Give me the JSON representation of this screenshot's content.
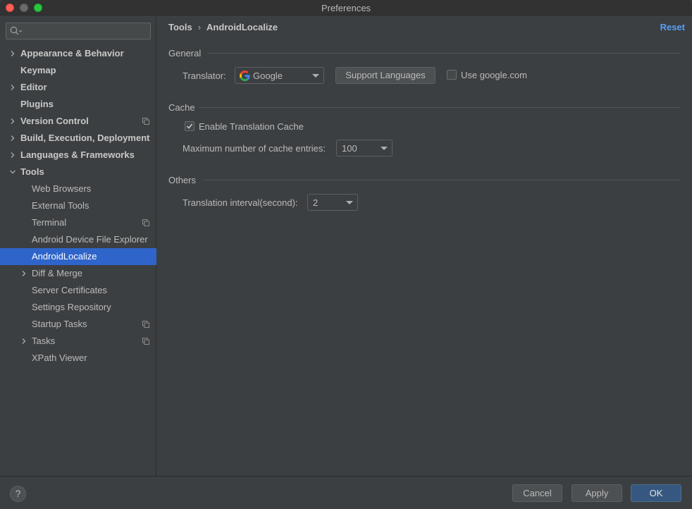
{
  "window": {
    "title": "Preferences"
  },
  "search": {
    "placeholder": ""
  },
  "sidebar": {
    "items": [
      {
        "label": "Appearance & Behavior",
        "level": 0,
        "expandable": true,
        "expanded": false,
        "badge": false,
        "selected": false
      },
      {
        "label": "Keymap",
        "level": 0,
        "expandable": false,
        "badge": false,
        "selected": false
      },
      {
        "label": "Editor",
        "level": 0,
        "expandable": true,
        "expanded": false,
        "badge": false,
        "selected": false
      },
      {
        "label": "Plugins",
        "level": 0,
        "expandable": false,
        "badge": false,
        "selected": false
      },
      {
        "label": "Version Control",
        "level": 0,
        "expandable": true,
        "expanded": false,
        "badge": true,
        "selected": false
      },
      {
        "label": "Build, Execution, Deployment",
        "level": 0,
        "expandable": true,
        "expanded": false,
        "badge": false,
        "selected": false
      },
      {
        "label": "Languages & Frameworks",
        "level": 0,
        "expandable": true,
        "expanded": false,
        "badge": false,
        "selected": false
      },
      {
        "label": "Tools",
        "level": 0,
        "expandable": true,
        "expanded": true,
        "badge": false,
        "selected": false
      },
      {
        "label": "Web Browsers",
        "level": 1,
        "expandable": false,
        "badge": false,
        "selected": false
      },
      {
        "label": "External Tools",
        "level": 1,
        "expandable": false,
        "badge": false,
        "selected": false
      },
      {
        "label": "Terminal",
        "level": 1,
        "expandable": false,
        "badge": true,
        "selected": false
      },
      {
        "label": "Android Device File Explorer",
        "level": 1,
        "expandable": false,
        "badge": false,
        "selected": false
      },
      {
        "label": "AndroidLocalize",
        "level": 1,
        "expandable": false,
        "badge": false,
        "selected": true
      },
      {
        "label": "Diff & Merge",
        "level": 1,
        "expandable": true,
        "expanded": false,
        "badge": false,
        "selected": false
      },
      {
        "label": "Server Certificates",
        "level": 1,
        "expandable": false,
        "badge": false,
        "selected": false
      },
      {
        "label": "Settings Repository",
        "level": 1,
        "expandable": false,
        "badge": false,
        "selected": false
      },
      {
        "label": "Startup Tasks",
        "level": 1,
        "expandable": false,
        "badge": true,
        "selected": false
      },
      {
        "label": "Tasks",
        "level": 1,
        "expandable": true,
        "expanded": false,
        "badge": true,
        "selected": false
      },
      {
        "label": "XPath Viewer",
        "level": 1,
        "expandable": false,
        "badge": false,
        "selected": false
      }
    ]
  },
  "breadcrumb": {
    "parent": "Tools",
    "separator": "›",
    "current": "AndroidLocalize"
  },
  "reset_label": "Reset",
  "general": {
    "title": "General",
    "translator_label": "Translator:",
    "translator_value": "Google",
    "support_languages_label": "Support Languages",
    "use_google_label": "Use google.com",
    "use_google_checked": false
  },
  "cache": {
    "title": "Cache",
    "enable_label": "Enable Translation Cache",
    "enable_checked": true,
    "max_entries_label": "Maximum number of cache entries:",
    "max_entries_value": "100"
  },
  "others": {
    "title": "Others",
    "interval_label": "Translation interval(second):",
    "interval_value": "2"
  },
  "footer": {
    "help_label": "?",
    "cancel_label": "Cancel",
    "apply_label": "Apply",
    "ok_label": "OK"
  },
  "colors": {
    "background": "#3c3f41",
    "selection": "#2f65ca",
    "link": "#589df6",
    "primary_button": "#365880"
  }
}
